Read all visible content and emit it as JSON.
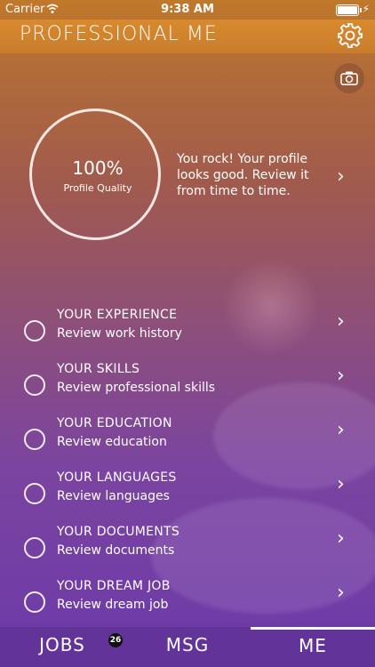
{
  "status": {
    "carrier": "Carrier",
    "time": "9:38 AM"
  },
  "header": {
    "title": "PROFESSIONAL ME"
  },
  "profile": {
    "percent": "100%",
    "label": "Profile Quality",
    "message": "You rock! Your profile looks good. Review it from time to time."
  },
  "items": [
    {
      "title": "YOUR EXPERIENCE",
      "subtitle": "Review work history"
    },
    {
      "title": "YOUR SKILLS",
      "subtitle": "Review professional skills"
    },
    {
      "title": "YOUR EDUCATION",
      "subtitle": "Review education"
    },
    {
      "title": "YOUR LANGUAGES",
      "subtitle": "Review languages"
    },
    {
      "title": "YOUR DOCUMENTS",
      "subtitle": "Review documents"
    },
    {
      "title": "YOUR DREAM JOB",
      "subtitle": "Review dream job"
    }
  ],
  "tabs": [
    {
      "label": "JOBS",
      "badge": "26"
    },
    {
      "label": "MSG"
    },
    {
      "label": "ME"
    }
  ],
  "icons": {
    "settings": "gear-icon",
    "camera": "camera-icon",
    "chevron": "chevron-right-icon"
  }
}
